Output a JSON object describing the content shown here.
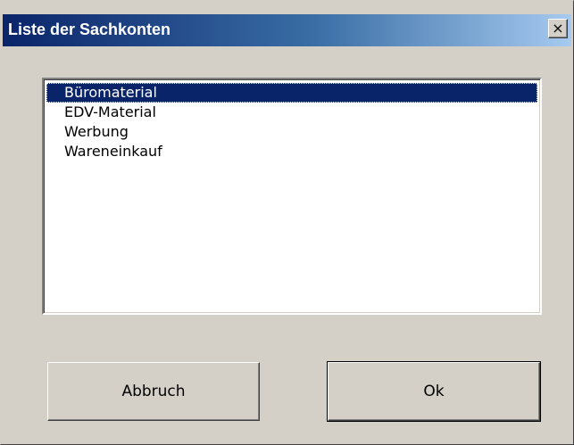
{
  "window": {
    "title": "Liste der Sachkonten",
    "close_label": "×"
  },
  "list": {
    "items": [
      {
        "label": "Büromaterial",
        "selected": true
      },
      {
        "label": "EDV-Material",
        "selected": false
      },
      {
        "label": "Werbung",
        "selected": false
      },
      {
        "label": "Wareneinkauf",
        "selected": false
      }
    ]
  },
  "buttons": {
    "cancel_label": "Abbruch",
    "ok_label": "Ok"
  },
  "colors": {
    "face": "#d4d0c8",
    "title_start": "#0a246a",
    "title_end": "#a6caf0",
    "selection": "#0a246a"
  }
}
